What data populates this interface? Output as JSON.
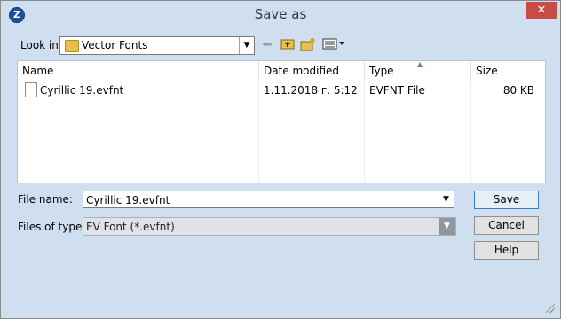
{
  "window": {
    "title": "Save as",
    "app_icon_letter": "Z",
    "close_symbol": "✕"
  },
  "toolbar": {
    "lookin_label": "Look in:",
    "lookin_value": "Vector Fonts",
    "icons": [
      "back-arrow-icon",
      "up-folder-icon",
      "new-folder-icon",
      "view-menu-icon"
    ]
  },
  "filelist": {
    "columns": [
      "Name",
      "Date modified",
      "Type",
      "Size"
    ],
    "sorted_column": "Type",
    "rows": [
      {
        "name": "Cyrillic 19.evfnt",
        "date": "1.11.2018 г. 5:12",
        "type": "EVFNT File",
        "size": "80 KB"
      }
    ]
  },
  "form": {
    "filename_label": "File name:",
    "filename_value": "Cyrillic 19.evfnt",
    "filetype_label": "Files of type:",
    "filetype_value": "EV Font (*.evfnt)"
  },
  "buttons": {
    "save": "Save",
    "cancel": "Cancel",
    "help": "Help"
  },
  "colors": {
    "chrome": "#cfdff0",
    "close": "#c84b44",
    "default_button_border": "#3a7bd5"
  }
}
